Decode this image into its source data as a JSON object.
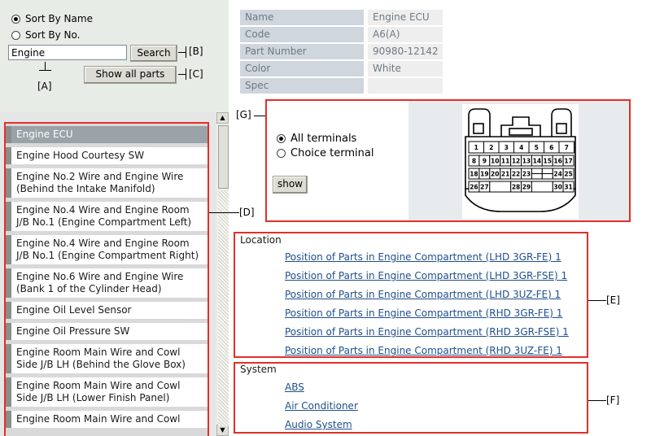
{
  "search": {
    "sort_by_name": "Sort By Name",
    "sort_by_no": "Sort By No.",
    "query": "Engine",
    "search_button": "Search",
    "show_all_button": "Show all parts"
  },
  "callouts": {
    "a": "[A]",
    "b": "[B]",
    "c": "[C]",
    "d": "[D]",
    "e": "[E]",
    "f": "[F]",
    "g": "[G]"
  },
  "parts_list": [
    {
      "label_1": "Engine ECU",
      "label_2": "",
      "selected": true
    },
    {
      "label_1": "Engine Hood Courtesy SW",
      "label_2": ""
    },
    {
      "label_1": "Engine No.2 Wire and Engine Wire",
      "label_2": "(Behind the Intake Manifold)"
    },
    {
      "label_1": "Engine No.4 Wire and Engine Room",
      "label_2": "J/B No.1 (Engine Compartment Left)"
    },
    {
      "label_1": "Engine No.4 Wire and Engine Room",
      "label_2": "J/B No.1 (Engine Compartment Right)"
    },
    {
      "label_1": "Engine No.6 Wire and Engine Wire",
      "label_2": "(Bank 1 of the Cylinder Head)"
    },
    {
      "label_1": "Engine Oil Level Sensor",
      "label_2": ""
    },
    {
      "label_1": "Engine Oil Pressure SW",
      "label_2": ""
    },
    {
      "label_1": "Engine Room Main Wire and Cowl",
      "label_2": "Side J/B LH (Behind the Glove Box)"
    },
    {
      "label_1": "Engine Room Main Wire and Cowl",
      "label_2": "Side J/B LH (Lower Finish Panel)"
    },
    {
      "label_1": "Engine Room Main Wire and Cowl",
      "label_2": ""
    }
  ],
  "info": {
    "name_label": "Name",
    "name_value": "Engine ECU",
    "code_label": "Code",
    "code_value": "A6(A)",
    "part_label": "Part Number",
    "part_value": "90980-12142",
    "color_label": "Color",
    "color_value": "White",
    "spec_label": "Spec",
    "spec_value": ""
  },
  "terminal": {
    "all_terminals": "All terminals",
    "choice_terminal": "Choice terminal",
    "show_button": "show",
    "pins_row1": [
      "1",
      "2",
      "3",
      "4",
      "5",
      "6",
      "7"
    ],
    "pins_row2": [
      "8",
      "9",
      "10",
      "11",
      "12",
      "13",
      "14",
      "15",
      "16",
      "17"
    ],
    "pins_row3": [
      "18",
      "19",
      "20",
      "21",
      "22",
      "23",
      "24",
      "25"
    ],
    "pins_row4": [
      "26",
      "27",
      "28",
      "29",
      "30",
      "31"
    ]
  },
  "location": {
    "title": "Location",
    "links": [
      "Position of Parts in Engine Compartment (LHD 3GR-FE) 1",
      "Position of Parts in Engine Compartment (LHD 3GR-FSE) 1",
      "Position of Parts in Engine Compartment (LHD 3UZ-FE) 1",
      "Position of Parts in Engine Compartment (RHD 3GR-FE) 1",
      "Position of Parts in Engine Compartment (RHD 3GR-FSE) 1",
      "Position of Parts in Engine Compartment (RHD 3UZ-FE) 1"
    ]
  },
  "system": {
    "title": "System",
    "links": [
      "ABS",
      "Air Conditioner",
      "Audio System"
    ]
  },
  "colors": {
    "callout_border": "#e0302a",
    "link": "#1f4f8c",
    "selected_item": "#9aa3a8"
  }
}
